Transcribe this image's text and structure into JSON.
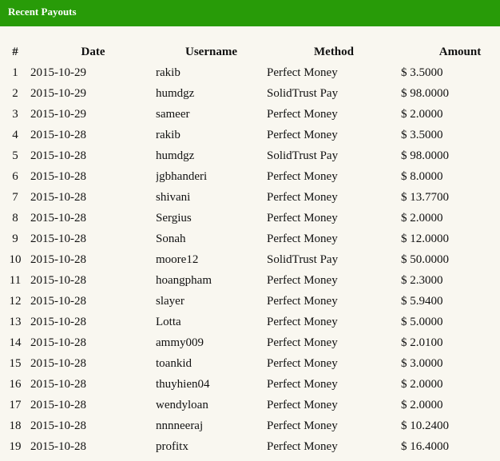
{
  "header": {
    "title": "Recent Payouts"
  },
  "colors": {
    "header_bg": "#289b08",
    "header_text": "#ffffff",
    "page_bg": "#f9f7f0",
    "text": "#111111"
  },
  "table": {
    "columns": [
      "#",
      "Date",
      "Username",
      "Method",
      "Amount"
    ],
    "column_keys": [
      "number",
      "date",
      "username",
      "method",
      "amount"
    ],
    "rows": [
      [
        "1",
        "2015-10-29",
        "rakib",
        "Perfect Money",
        "$ 3.5000"
      ],
      [
        "2",
        "2015-10-29",
        "humdgz",
        "SolidTrust Pay",
        "$ 98.0000"
      ],
      [
        "3",
        "2015-10-29",
        "sameer",
        "Perfect Money",
        "$ 2.0000"
      ],
      [
        "4",
        "2015-10-28",
        "rakib",
        "Perfect Money",
        "$ 3.5000"
      ],
      [
        "5",
        "2015-10-28",
        "humdgz",
        "SolidTrust Pay",
        "$ 98.0000"
      ],
      [
        "6",
        "2015-10-28",
        "jgbhanderi",
        "Perfect Money",
        "$ 8.0000"
      ],
      [
        "7",
        "2015-10-28",
        "shivani",
        "Perfect Money",
        "$ 13.7700"
      ],
      [
        "8",
        "2015-10-28",
        "Sergius",
        "Perfect Money",
        "$ 2.0000"
      ],
      [
        "9",
        "2015-10-28",
        "Sonah",
        "Perfect Money",
        "$ 12.0000"
      ],
      [
        "10",
        "2015-10-28",
        "moore12",
        "SolidTrust Pay",
        "$ 50.0000"
      ],
      [
        "11",
        "2015-10-28",
        "hoangpham",
        "Perfect Money",
        "$ 2.3000"
      ],
      [
        "12",
        "2015-10-28",
        "slayer",
        "Perfect Money",
        "$ 5.9400"
      ],
      [
        "13",
        "2015-10-28",
        "Lotta",
        "Perfect Money",
        "$ 5.0000"
      ],
      [
        "14",
        "2015-10-28",
        "ammy009",
        "Perfect Money",
        "$ 2.0100"
      ],
      [
        "15",
        "2015-10-28",
        "toankid",
        "Perfect Money",
        "$ 3.0000"
      ],
      [
        "16",
        "2015-10-28",
        "thuyhien04",
        "Perfect Money",
        "$ 2.0000"
      ],
      [
        "17",
        "2015-10-28",
        "wendyloan",
        "Perfect Money",
        "$ 2.0000"
      ],
      [
        "18",
        "2015-10-28",
        "nnnneeraj",
        "Perfect Money",
        "$ 10.2400"
      ],
      [
        "19",
        "2015-10-28",
        "profitx",
        "Perfect Money",
        "$ 16.4000"
      ]
    ]
  }
}
